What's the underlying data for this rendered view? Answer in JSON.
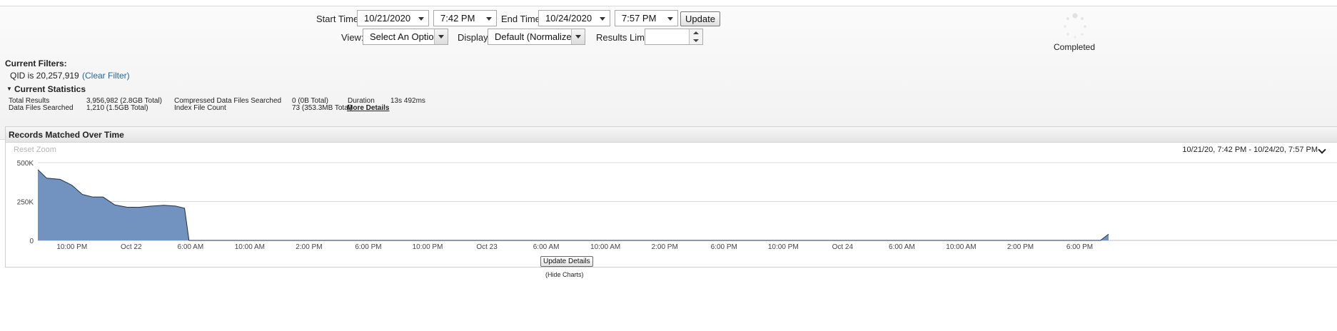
{
  "toolbar": {
    "start_time_label": "Start Time",
    "start_date": "10/21/2020",
    "start_time": "7:42 PM",
    "end_time_label": "End Time",
    "end_date": "10/24/2020",
    "end_time": "7:57 PM",
    "update_label": "Update",
    "view_label": "View:",
    "view_value": "Select An Option:",
    "display_label": "Display:",
    "display_value": "Default (Normalized)",
    "results_limit_label": "Results Limit",
    "results_limit_value": ""
  },
  "status": {
    "text": "Completed"
  },
  "filters": {
    "heading": "Current Filters:",
    "filter_text": "QID is 20,257,919",
    "clear_label": "(Clear Filter)"
  },
  "statistics": {
    "heading": "Current Statistics",
    "total_results_label": "Total Results",
    "total_results_value": "3,956,982 (2.8GB Total)",
    "data_files_label": "Data Files Searched",
    "data_files_value": "1,210 (1.5GB Total)",
    "compressed_label": "Compressed Data Files Searched",
    "compressed_value": "0 (0B Total)",
    "index_label": "Index File Count",
    "index_value": "73 (353.3MB Total)",
    "duration_label": "Duration",
    "duration_value": "13s 492ms",
    "more_details_label": "More Details"
  },
  "chart_panel": {
    "title": "Records Matched Over Time",
    "reset_zoom_label": "Reset Zoom",
    "range_label": "10/21/20, 7:42 PM - 10/24/20, 7:57 PM",
    "update_details_label": "Update Details",
    "hide_charts_label": "(Hide Charts)"
  },
  "colors": {
    "area_fill": "#7293bf",
    "area_stroke": "#1f2f45",
    "link": "#2a6496",
    "panel_bg": "#f4f4f4"
  },
  "chart_data": {
    "type": "area",
    "title": "Records Matched Over Time",
    "xlabel": "",
    "ylabel": "",
    "ylim": [
      0,
      500000
    ],
    "yticks": [
      0,
      250000,
      500000
    ],
    "ytick_labels": [
      "0",
      "250K",
      "500K"
    ],
    "xtick_labels": [
      "10:00 PM",
      "Oct 22",
      "6:00 AM",
      "10:00 AM",
      "2:00 PM",
      "6:00 PM",
      "10:00 PM",
      "Oct 23",
      "6:00 AM",
      "10:00 AM",
      "2:00 PM",
      "6:00 PM",
      "10:00 PM",
      "Oct 24",
      "6:00 AM",
      "10:00 AM",
      "2:00 PM",
      "6:00 PM"
    ],
    "grid": true,
    "legend": "none",
    "x_hours_from_start": [
      0,
      0.6,
      1.5,
      2.3,
      3.0,
      3.7,
      4.4,
      5.2,
      6.0,
      6.8,
      7.6,
      8.5,
      9.3,
      9.9,
      10.2,
      71.7,
      72.25
    ],
    "values": [
      455000,
      400000,
      393000,
      355000,
      296000,
      279000,
      279000,
      228000,
      214000,
      213000,
      220000,
      226000,
      221000,
      207000,
      0,
      0,
      40000
    ]
  }
}
